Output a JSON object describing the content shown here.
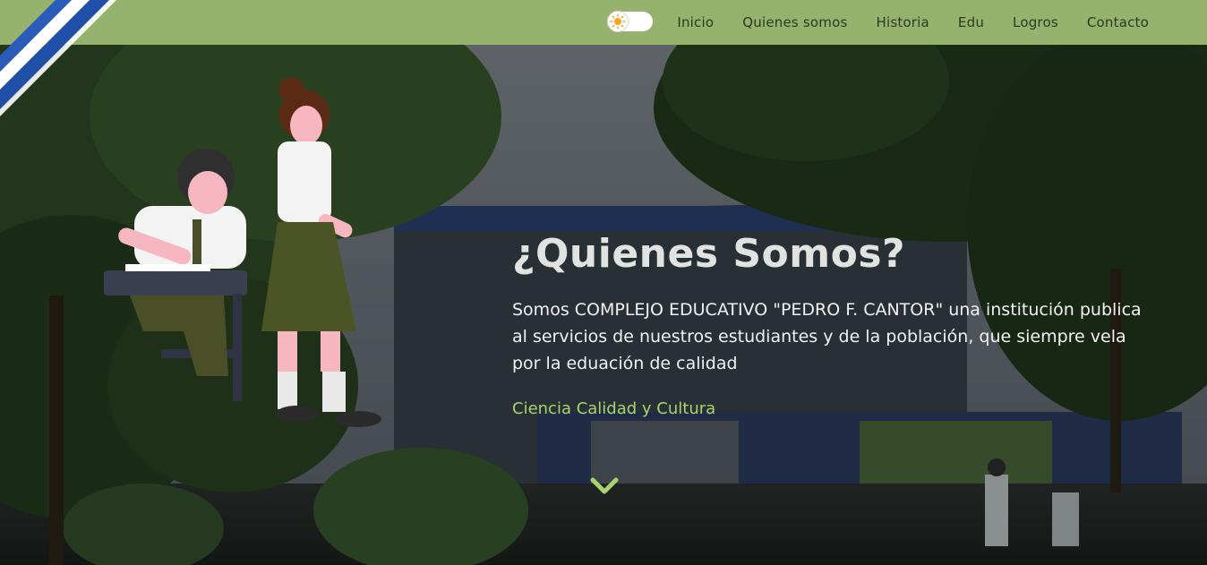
{
  "nav": {
    "items": [
      {
        "label": "Inicio"
      },
      {
        "label": "Quienes somos"
      },
      {
        "label": "Historia"
      },
      {
        "label": "Edu"
      },
      {
        "label": "Logros"
      },
      {
        "label": "Contacto"
      }
    ],
    "theme_toggle_icon": "sun-icon"
  },
  "hero": {
    "title": "¿Quienes Somos?",
    "description": "Somos COMPLEJO EDUCATIVO \"PEDRO F. CANTOR\" una institución publica al servicios de nuestros estudiantes y de la población, que siempre vela por la eduación de calidad",
    "slogan": "Ciencia Calidad y Cultura",
    "scroll_icon": "chevron-down-icon"
  },
  "colors": {
    "navbar": "#95b36c",
    "accent": "#a9d36f",
    "flag_blue": "#1f4fa8",
    "flag_white": "#ffffff"
  }
}
